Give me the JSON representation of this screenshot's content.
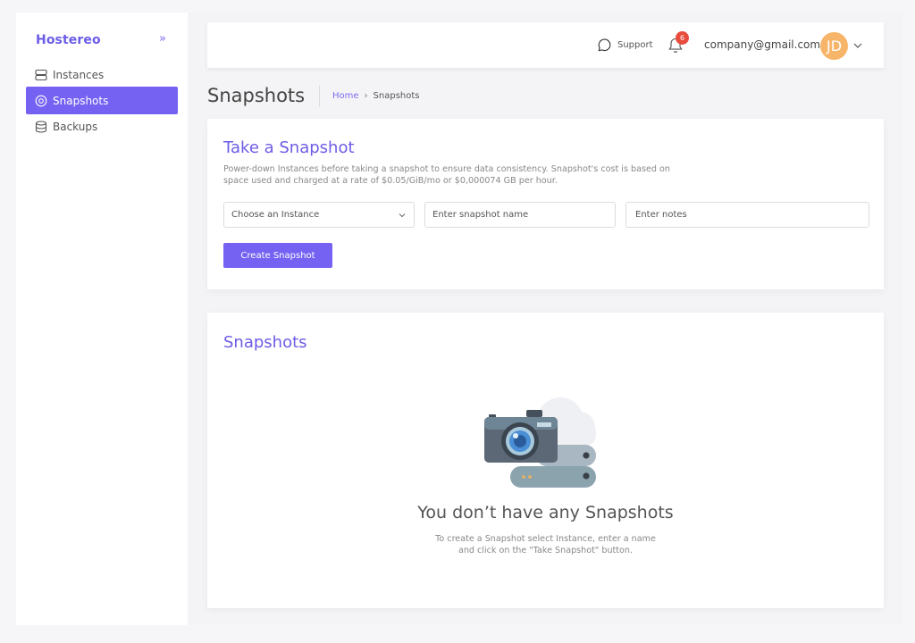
{
  "sidebar": {
    "brand": "Hostereo",
    "collapse_icon": "double-chevron-right",
    "items": [
      {
        "label": "Instances",
        "icon": "server-icon",
        "active": false
      },
      {
        "label": "Snapshots",
        "icon": "snapshot-icon",
        "active": true
      },
      {
        "label": "Backups",
        "icon": "database-icon",
        "active": false
      }
    ]
  },
  "topbar": {
    "support_label": "Support",
    "notification_count": "6",
    "email": "company@gmail.com",
    "avatar_initials": "JD"
  },
  "header": {
    "title": "Snapshots",
    "breadcrumb": [
      "Home",
      "Snapshots"
    ]
  },
  "take_snapshot": {
    "title": "Take a Snapshot",
    "description": "Power-down Instances before taking a snapshot to ensure data consistency. Snapshot's cost is based on space used and charged at a rate of $0.05/GiB/mo or $0,000074 GB per hour.",
    "instance_select": "Choose an Instance",
    "name_placeholder": "Enter snapshot name",
    "notes_placeholder": "Enter notes",
    "create_button": "Create Snapshot"
  },
  "snapshots": {
    "title": "Snapshots",
    "empty_title": "You don’t have any Snapshots",
    "empty_desc_1": "To create a Snapshot select Instance, enter a name",
    "empty_desc_2": "and click on the \"Take Snapshot\" button."
  },
  "colors": {
    "accent": "#7562f2",
    "badge": "#e74c3c",
    "avatar": "#f7b56a"
  }
}
